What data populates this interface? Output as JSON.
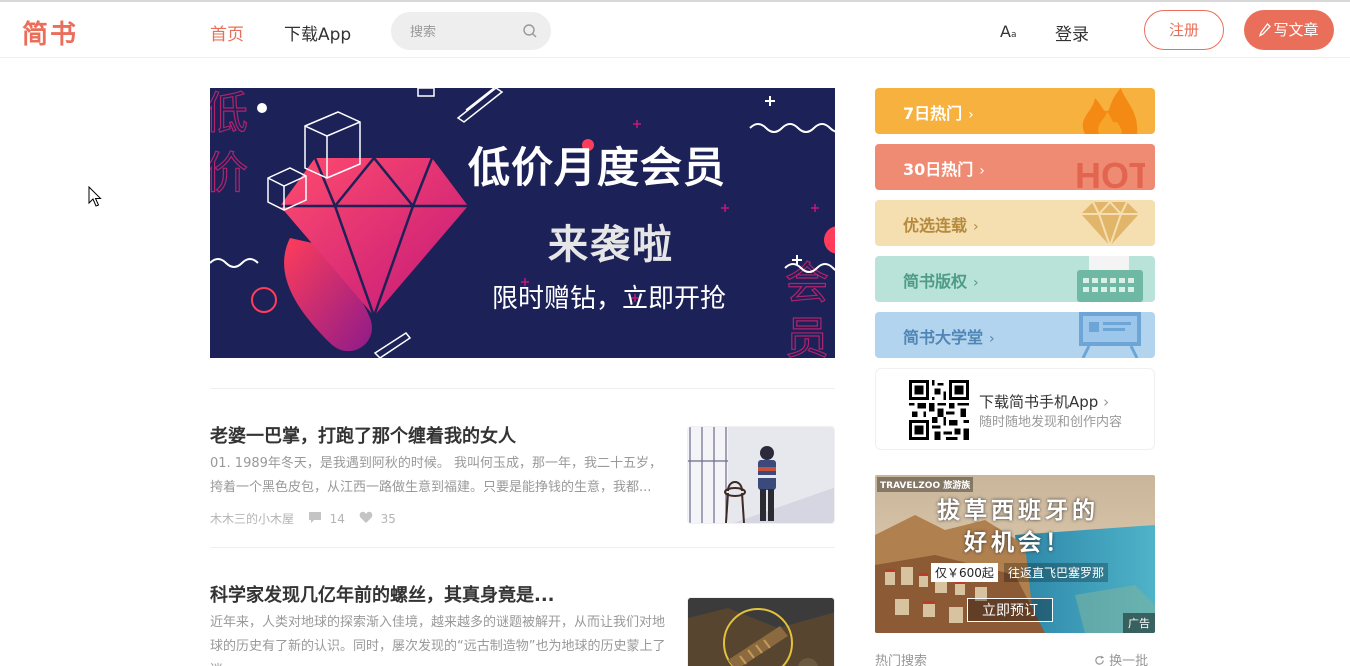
{
  "header": {
    "logo": "简书",
    "nav_home": "首页",
    "nav_app": "下载App",
    "search_placeholder": "搜索",
    "font_toggle_main": "A",
    "font_toggle_small": "a",
    "login": "登录",
    "register": "注册",
    "write": "写文章"
  },
  "banner": {
    "title": "低价月度会员",
    "subtitle": "来袭啦",
    "line": "限时赠钻，立即开抢"
  },
  "articles": [
    {
      "title": "老婆一巴掌，打跑了那个缠着我的女人",
      "abstract": "01. 1989年冬天，是我遇到阿秋的时候。 我叫何玉成，那一年，我二十五岁，挎着一个黑色皮包，从江西一路做生意到福建。只要是能挣钱的生意，我都...",
      "author": "木木三的小木屋",
      "comments": "14",
      "likes": "35"
    },
    {
      "title": "科学家发现几亿年前的螺丝，其真身竟是...",
      "abstract": "近年来，人类对地球的探索渐入佳境，越来越多的谜题被解开，从而让我们对地球的历史有了新的认识。同时，屡次发现的“远古制造物”也为地球的历史蒙上了迷...",
      "author": "",
      "comments": "",
      "likes": ""
    }
  ],
  "sidebar": {
    "boards": [
      {
        "label": "7日热门",
        "color": "#f7b13e",
        "icon": "flame-icon"
      },
      {
        "label": "30日热门",
        "color": "#f08b73",
        "icon": "hot-text-icon"
      },
      {
        "label": "优选连载",
        "color": "#f5deb0",
        "icon": "diamond-icon"
      },
      {
        "label": "简书版权",
        "color": "#b9e3d8",
        "icon": "typewriter-icon"
      },
      {
        "label": "简书大学堂",
        "color": "#b3d4ee",
        "icon": "screen-icon"
      }
    ],
    "app": {
      "title": "下载简书手机App",
      "desc": "随时随地发现和创作内容"
    },
    "ad": {
      "brand": "TRAVELZOO 旅游族",
      "headline_1": "拔草西班牙的",
      "headline_2": "好机会！",
      "price": "仅￥600起",
      "route": "往返直飞巴塞罗那",
      "cta": "立即预订",
      "tag": "广告"
    },
    "hot_search": "热门搜索",
    "refresh": "换一批"
  },
  "colors": {
    "brand": "#ea6f5a",
    "banner_bg": "#1c2157"
  }
}
